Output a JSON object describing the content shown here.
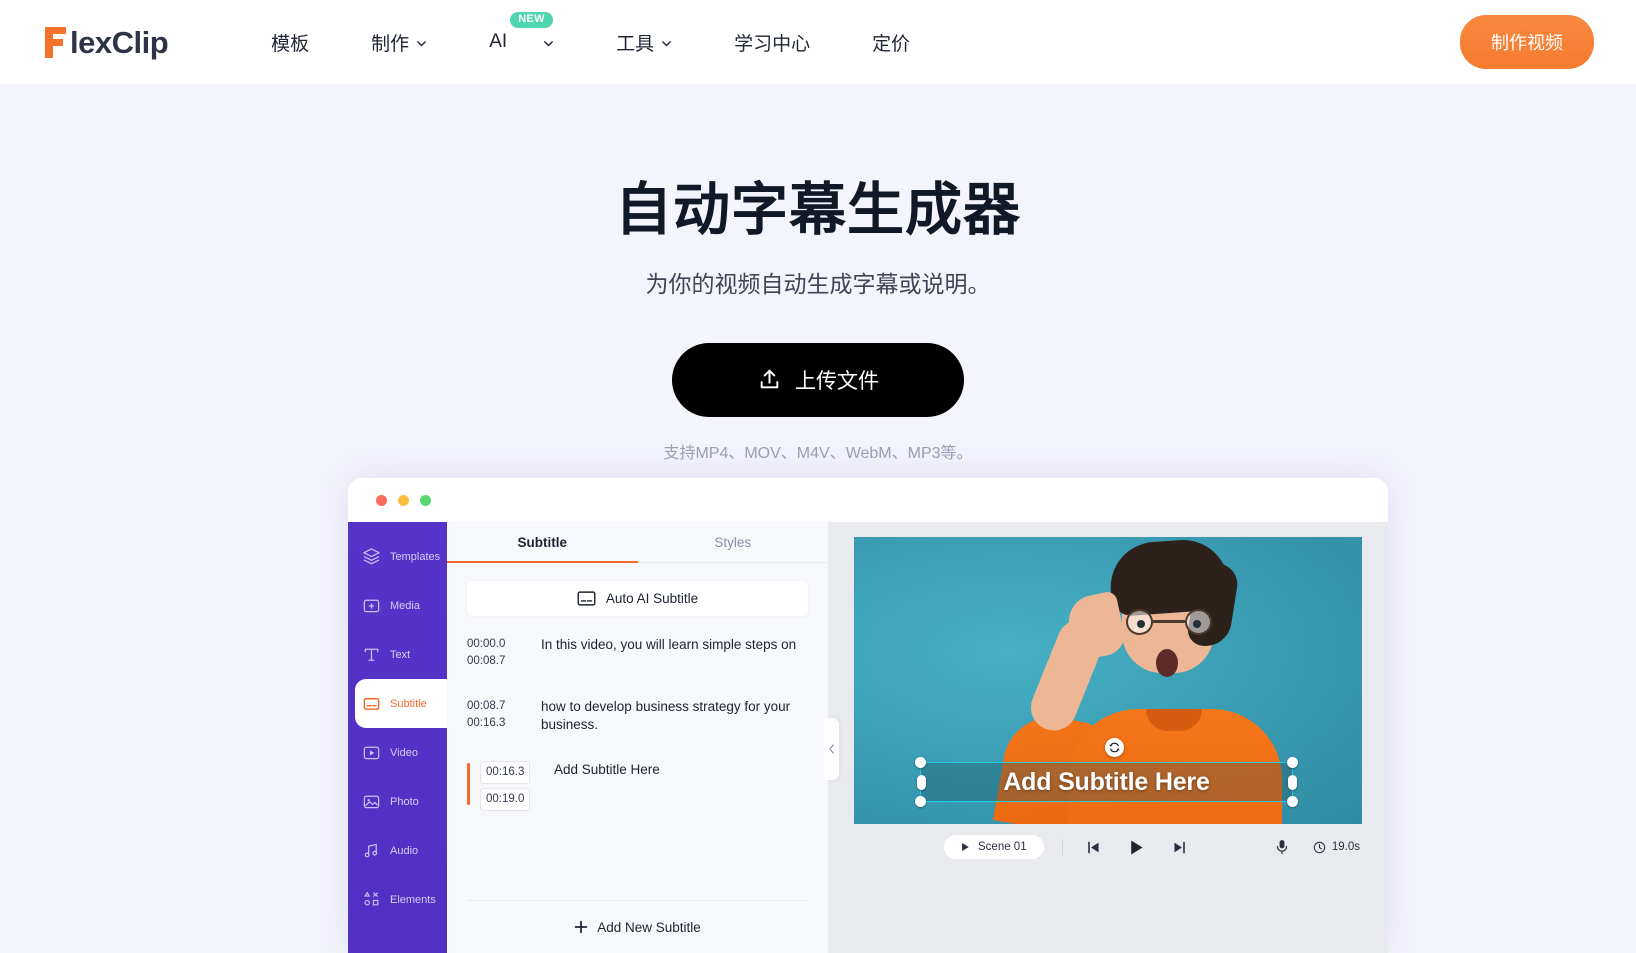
{
  "navbar": {
    "brand": "lexClip",
    "brand_full": "FlexClip",
    "links": [
      {
        "label": "模板",
        "has_caret": false,
        "badge": null
      },
      {
        "label": "制作",
        "has_caret": true,
        "badge": null
      },
      {
        "label": "AI",
        "has_caret": true,
        "badge": "NEW"
      },
      {
        "label": "工具",
        "has_caret": true,
        "badge": null
      },
      {
        "label": "学习中心",
        "has_caret": false,
        "badge": null
      },
      {
        "label": "定价",
        "has_caret": false,
        "badge": null
      }
    ],
    "cta_label": "制作视频",
    "cta_color": "#f57b2e"
  },
  "hero": {
    "title": "自动字幕生成器",
    "subtitle": "为你的视频自动生成字幕或说明。",
    "upload_label": "上传文件",
    "formats_note": "支持MP4、MOV、M4V、WebM、MP3等。"
  },
  "mockup": {
    "window_dots": [
      "red",
      "yellow",
      "green"
    ],
    "rail": [
      {
        "label": "Templates",
        "icon": "layers-icon",
        "active": false
      },
      {
        "label": "Media",
        "icon": "folder-plus-icon",
        "active": false
      },
      {
        "label": "Text",
        "icon": "text-t-icon",
        "active": false
      },
      {
        "label": "Subtitle",
        "icon": "subtitle-icon",
        "active": true
      },
      {
        "label": "Video",
        "icon": "video-icon",
        "active": false
      },
      {
        "label": "Photo",
        "icon": "photo-icon",
        "active": false
      },
      {
        "label": "Audio",
        "icon": "audio-note-icon",
        "active": false
      },
      {
        "label": "Elements",
        "icon": "elements-icon",
        "active": false
      }
    ],
    "panel": {
      "tabs": [
        {
          "label": "Subtitle",
          "active": true
        },
        {
          "label": "Styles",
          "active": false
        }
      ],
      "auto_ai_label": "Auto AI Subtitle",
      "subtitles": [
        {
          "start": "00:00.0",
          "end": "00:08.7",
          "text": "In this video, you will learn simple steps on",
          "selected": false
        },
        {
          "start": "00:08.7",
          "end": "00:16.3",
          "text": "how to develop business strategy for your business.",
          "selected": false
        },
        {
          "start": "00:16.3",
          "end": "00:19.0",
          "text": "Add Subtitle Here",
          "selected": true
        }
      ],
      "add_new_label": "Add New Subtitle"
    },
    "stage": {
      "subtitle_overlay_text": "Add Subtitle Here",
      "accent_select_color": "#22cbe4"
    },
    "player": {
      "scene_label": "Scene 01",
      "duration": "19.0s"
    }
  }
}
